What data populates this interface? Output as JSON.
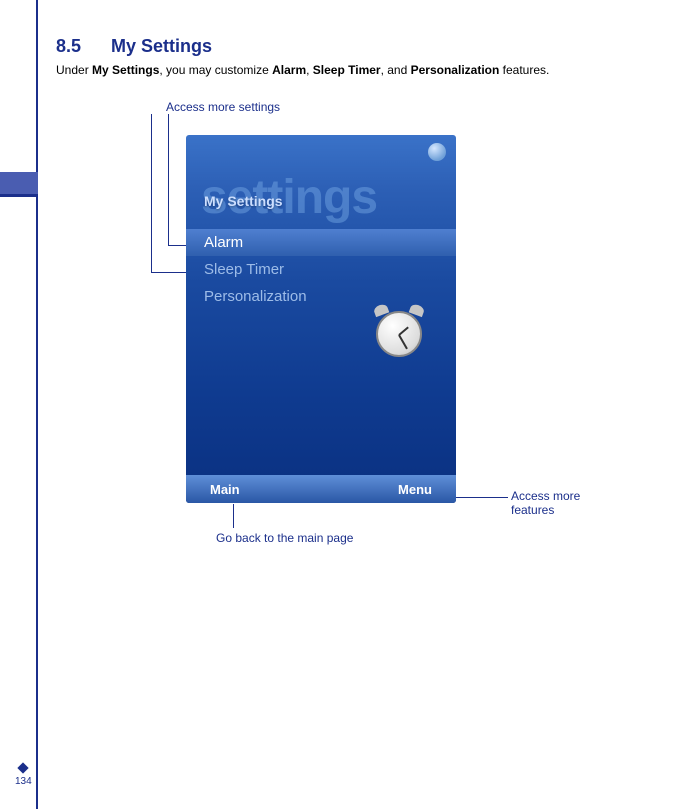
{
  "section": {
    "number": "8.5",
    "title": "My Settings"
  },
  "intro": {
    "pre": "Under ",
    "b1": "My Settings",
    "mid1": ", you may customize ",
    "b2": "Alarm",
    "mid2": ", ",
    "b3": "Sleep Timer",
    "mid3": ", and ",
    "b4": "Personalization",
    "post": " features."
  },
  "callouts": {
    "top": "Access more settings",
    "bottomLeft": "Go back to the main page",
    "bottomRight": "Access more features"
  },
  "phone": {
    "watermark": "settings",
    "heading": "My Settings",
    "items": [
      "Alarm",
      "Sleep Timer",
      "Personalization"
    ],
    "soft": {
      "left": "Main",
      "right": "Menu"
    }
  },
  "page": {
    "number": "134"
  }
}
